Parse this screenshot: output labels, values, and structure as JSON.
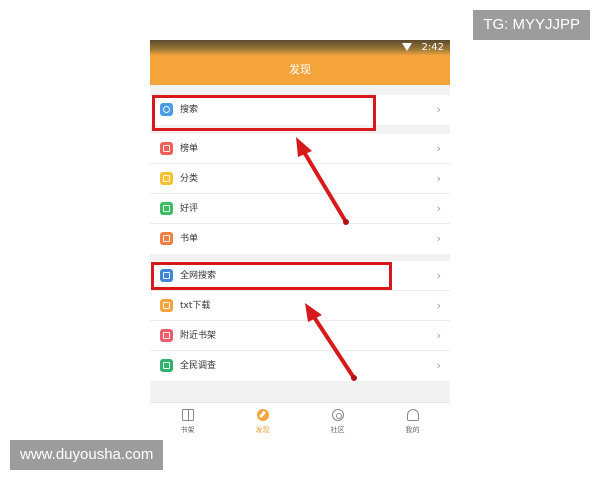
{
  "status_bar": {
    "time": "2:42",
    "wifi_icon": "wifi-icon"
  },
  "header": {
    "title": "发现"
  },
  "menu_groups": [
    {
      "items": [
        {
          "label": "搜索",
          "icon": "search-icon",
          "icon_color": "#4a9be8",
          "chevron": "›"
        }
      ]
    },
    {
      "items": [
        {
          "label": "榜单",
          "icon": "ranking-icon",
          "icon_color": "#f2605a",
          "chevron": "›"
        },
        {
          "label": "分类",
          "icon": "category-icon",
          "icon_color": "#f5c12e",
          "chevron": "›"
        },
        {
          "label": "好评",
          "icon": "thumbs-up-icon",
          "icon_color": "#3cbf61",
          "chevron": "›"
        },
        {
          "label": "书单",
          "icon": "booklist-icon",
          "icon_color": "#f07f43",
          "chevron": "›"
        }
      ]
    },
    {
      "items": [
        {
          "label": "全网搜索",
          "icon": "web-search-icon",
          "icon_color": "#3f86d8",
          "chevron": "›"
        },
        {
          "label": "txt下载",
          "icon": "txt-download-icon",
          "icon_color": "#f5a33b",
          "chevron": "›"
        },
        {
          "label": "附近书架",
          "icon": "nearby-shelf-icon",
          "icon_color": "#ee5b6a",
          "chevron": "›"
        },
        {
          "label": "全民调查",
          "icon": "survey-icon",
          "icon_color": "#2fb06e",
          "chevron": "›"
        }
      ]
    }
  ],
  "tabs": [
    {
      "label": "书架",
      "icon": "bookshelf-icon",
      "active": false
    },
    {
      "label": "发现",
      "icon": "compass-icon",
      "active": true
    },
    {
      "label": "社区",
      "icon": "community-icon",
      "active": false
    },
    {
      "label": "我的",
      "icon": "profile-icon",
      "active": false
    }
  ],
  "colors": {
    "accent": "#f5a33b",
    "highlight_red": "#d8191c"
  },
  "watermarks": {
    "top_right": "TG: MYYJJPP",
    "bottom_left": "www.duyousha.com"
  }
}
